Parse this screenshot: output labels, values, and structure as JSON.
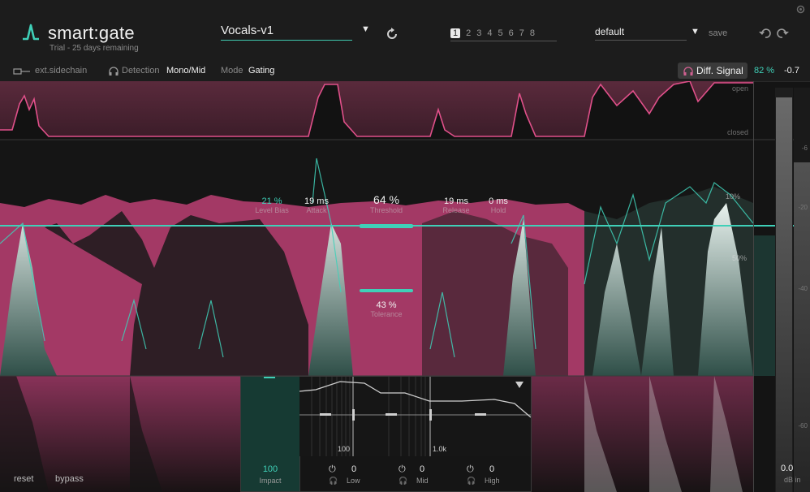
{
  "app": {
    "name": "smart:gate",
    "trial": "Trial - 25 days remaining"
  },
  "preset": {
    "name": "Vocals-v1"
  },
  "slots": {
    "items": [
      "1",
      "2",
      "3",
      "4",
      "5",
      "6",
      "7",
      "8"
    ],
    "active": "1"
  },
  "profile": {
    "name": "default",
    "save_label": "save"
  },
  "subbar": {
    "sidechain": "ext.sidechain",
    "detection_label": "Detection",
    "detection_value": "Mono/Mid",
    "mode_label": "Mode",
    "mode_value": "Gating",
    "diff_signal": "Diff. Signal",
    "mix": "82 %",
    "gain": "-0.7"
  },
  "envelope": {
    "open_label": "open",
    "closed_label": "closed"
  },
  "params": {
    "level_bias": {
      "value": "21 %",
      "label": "Level Bias"
    },
    "attack": {
      "value": "19 ms",
      "label": "Attack"
    },
    "threshold": {
      "value": "64 %",
      "label": "Threshold"
    },
    "release": {
      "value": "19 ms",
      "label": "Release"
    },
    "hold": {
      "value": "0 ms",
      "label": "Hold"
    },
    "tolerance": {
      "value": "43 %",
      "label": "Tolerance"
    }
  },
  "meter_marks": {
    "m50": "50%",
    "m10": "10%"
  },
  "eq": {
    "impact": {
      "value": "100",
      "label": "Impact"
    },
    "low": {
      "value": "0",
      "label": "Low"
    },
    "mid": {
      "value": "0",
      "label": "Mid"
    },
    "high": {
      "value": "0",
      "label": "High"
    },
    "freq_100": "100",
    "freq_1k": "1.0k"
  },
  "footer": {
    "reset": "reset",
    "bypass": "bypass"
  },
  "input_meter": {
    "value": "0.0",
    "label": "dB in",
    "ticks": [
      "-6",
      "-20",
      "-40",
      "-60"
    ]
  },
  "colors": {
    "accent": "#3fd0b8",
    "magenta": "#c4487a",
    "panel": "#1c1c1c"
  }
}
